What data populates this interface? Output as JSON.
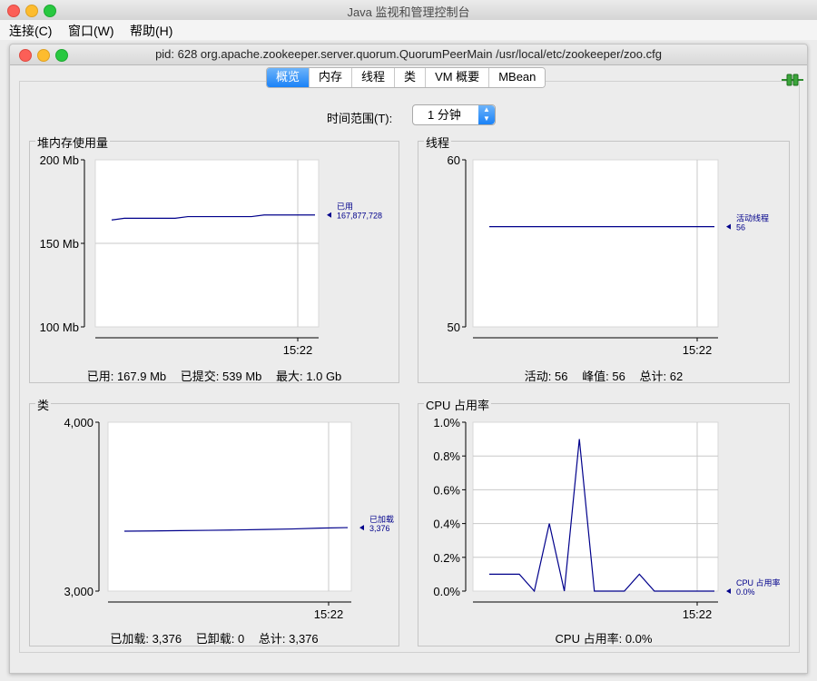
{
  "app": {
    "window_title": "Java 监视和管理控制台",
    "menu": [
      {
        "label": "连接(C)"
      },
      {
        "label": "窗口(W)"
      },
      {
        "label": "帮助(H)"
      }
    ]
  },
  "connection": {
    "title": "pid: 628 org.apache.zookeeper.server.quorum.QuorumPeerMain /usr/local/etc/zookeeper/zoo.cfg"
  },
  "tabs": [
    {
      "label": "概览",
      "active": true
    },
    {
      "label": "内存",
      "active": false
    },
    {
      "label": "线程",
      "active": false
    },
    {
      "label": "类",
      "active": false
    },
    {
      "label": "VM 概要",
      "active": false
    },
    {
      "label": "MBean",
      "active": false
    }
  ],
  "time_range": {
    "label": "时间范围(T):",
    "value": "1 分钟"
  },
  "colors": {
    "series": "#00008b",
    "grid": "#c8c8c8",
    "active_tab": "#1a82f7"
  },
  "chart_data": [
    {
      "type": "line",
      "title": "堆内存使用量",
      "ytick_labels": [
        "200 Mb",
        "150 Mb",
        "100 Mb"
      ],
      "ylim": [
        100,
        200
      ],
      "yticks": [
        200,
        150,
        100
      ],
      "xtick_label": "15:22",
      "series": [
        {
          "name": "已用",
          "value_label": "167,877,728",
          "x": [
            0,
            1,
            2,
            3,
            4,
            5,
            6,
            7,
            8,
            9,
            10,
            11,
            12,
            13,
            14,
            15,
            16
          ],
          "values": [
            164,
            165,
            165,
            165,
            165,
            165,
            166,
            166,
            166,
            166,
            166,
            166,
            167,
            167,
            167,
            167,
            167
          ]
        }
      ],
      "footer": [
        {
          "label": "已用:",
          "value": "167.9 Mb"
        },
        {
          "label": "已提交:",
          "value": "539 Mb"
        },
        {
          "label": "最大:",
          "value": "1.0 Gb"
        }
      ]
    },
    {
      "type": "line",
      "title": "线程",
      "ytick_labels": [
        "60",
        "50"
      ],
      "ylim": [
        50,
        60
      ],
      "yticks": [
        60,
        50
      ],
      "xtick_label": "15:22",
      "series": [
        {
          "name": "活动线程",
          "value_label": "56",
          "x": [
            0,
            16
          ],
          "values": [
            56,
            56
          ]
        }
      ],
      "footer": [
        {
          "label": "活动:",
          "value": "56"
        },
        {
          "label": "峰值:",
          "value": "56"
        },
        {
          "label": "总计:",
          "value": "62"
        }
      ]
    },
    {
      "type": "line",
      "title": "类",
      "ytick_labels": [
        "4,000",
        "3,000"
      ],
      "ylim": [
        3000,
        4000
      ],
      "yticks": [
        4000,
        3000
      ],
      "xtick_label": "15:22",
      "series": [
        {
          "name": "已加载",
          "value_label": "3,376",
          "x": [
            0,
            2,
            4,
            6,
            8,
            10,
            12,
            14,
            16
          ],
          "values": [
            3355,
            3356,
            3358,
            3360,
            3362,
            3365,
            3368,
            3373,
            3376
          ]
        }
      ],
      "footer": [
        {
          "label": "已加载:",
          "value": "3,376"
        },
        {
          "label": "已卸载:",
          "value": "0"
        },
        {
          "label": "总计:",
          "value": "3,376"
        }
      ]
    },
    {
      "type": "line",
      "title": "CPU 占用率",
      "ytick_labels": [
        "1.0%",
        "0.8%",
        "0.6%",
        "0.4%",
        "0.2%",
        "0.0%"
      ],
      "ylim": [
        0,
        1.0
      ],
      "yticks": [
        1.0,
        0.8,
        0.6,
        0.4,
        0.2,
        0.0
      ],
      "xtick_label": "15:22",
      "series": [
        {
          "name": "CPU 占用率",
          "value_label": "0.0%",
          "x": [
            0,
            1,
            2,
            3,
            4,
            5,
            6,
            7,
            8,
            9,
            10,
            11,
            12,
            13,
            14,
            15
          ],
          "values": [
            0.1,
            0.1,
            0.1,
            0.0,
            0.4,
            0.0,
            0.9,
            0.0,
            0.0,
            0.0,
            0.1,
            0.0,
            0.0,
            0.0,
            0.0,
            0.0
          ]
        }
      ],
      "footer": [
        {
          "label": "CPU 占用率:",
          "value": "0.0%"
        }
      ]
    }
  ]
}
